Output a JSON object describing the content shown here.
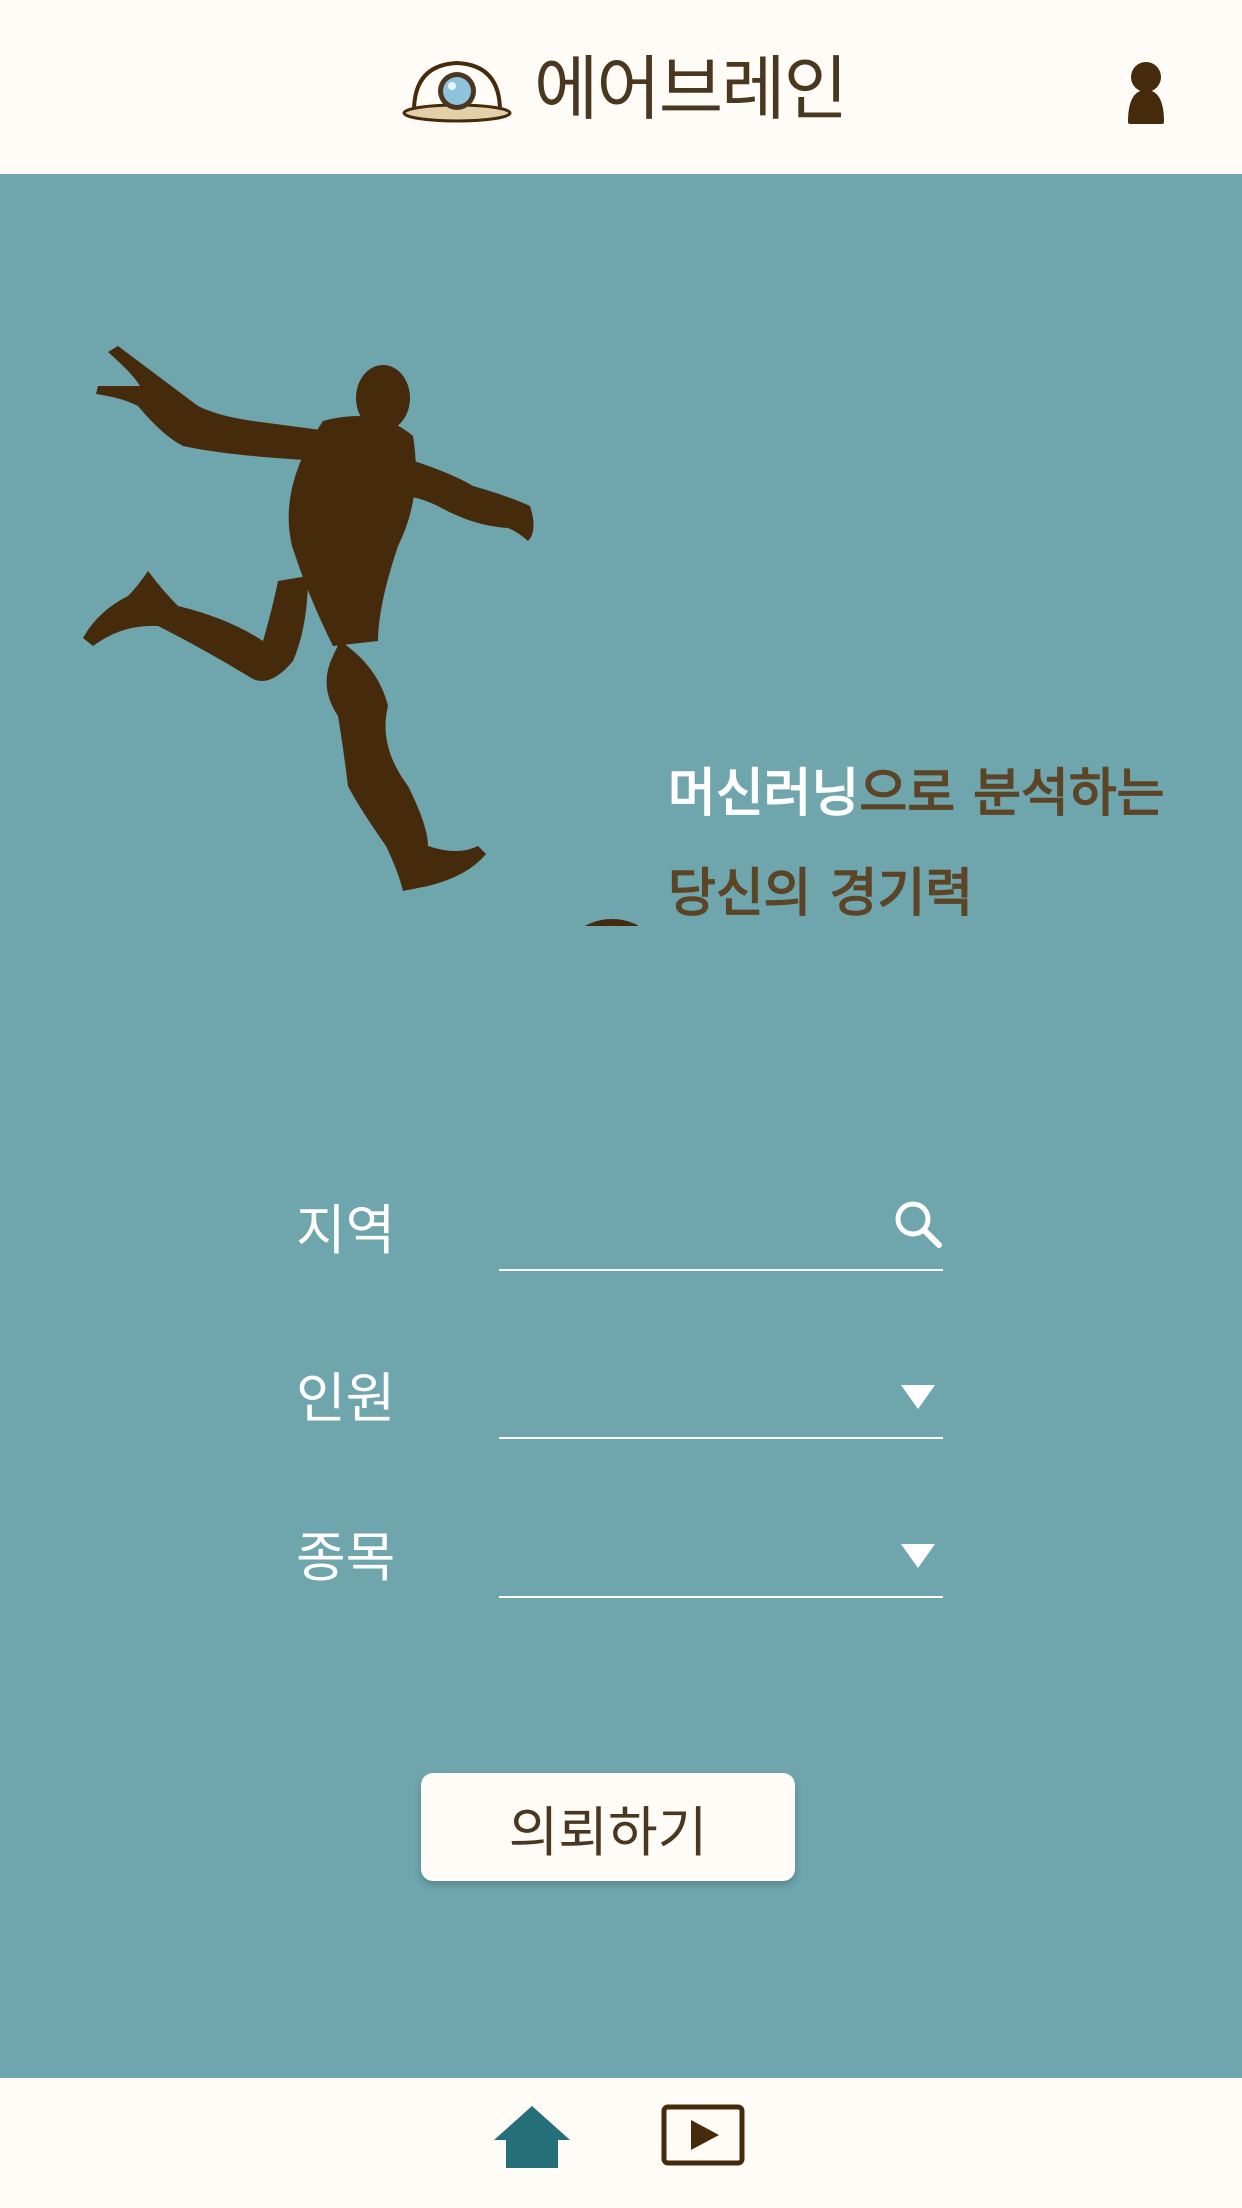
{
  "header": {
    "app_title": "에어브레인",
    "logo_icon": "helmet-eye-logo-icon",
    "user_icon": "user-icon"
  },
  "hero": {
    "illustration": "soccer-player-silhouette",
    "tagline_highlight": "머신러닝",
    "tagline_rest_line1": "으로 분석하는",
    "tagline_line2": "당신의 경기력"
  },
  "form": {
    "region": {
      "label": "지역",
      "value": "",
      "placeholder": "",
      "icon": "search-icon"
    },
    "people": {
      "label": "인원",
      "value": "",
      "icon": "chevron-down-icon"
    },
    "sport": {
      "label": "종목",
      "value": "",
      "icon": "chevron-down-icon"
    },
    "submit_label": "의뢰하기"
  },
  "bottom_nav": {
    "home_icon": "home-icon",
    "video_icon": "video-play-icon"
  },
  "colors": {
    "background": "#6fa5ad",
    "header_bg": "#fffcf8",
    "brown": "#452b0c",
    "title_text": "#4a3720",
    "tagline_text": "#5b4526",
    "nav_home_active": "#256f78"
  }
}
